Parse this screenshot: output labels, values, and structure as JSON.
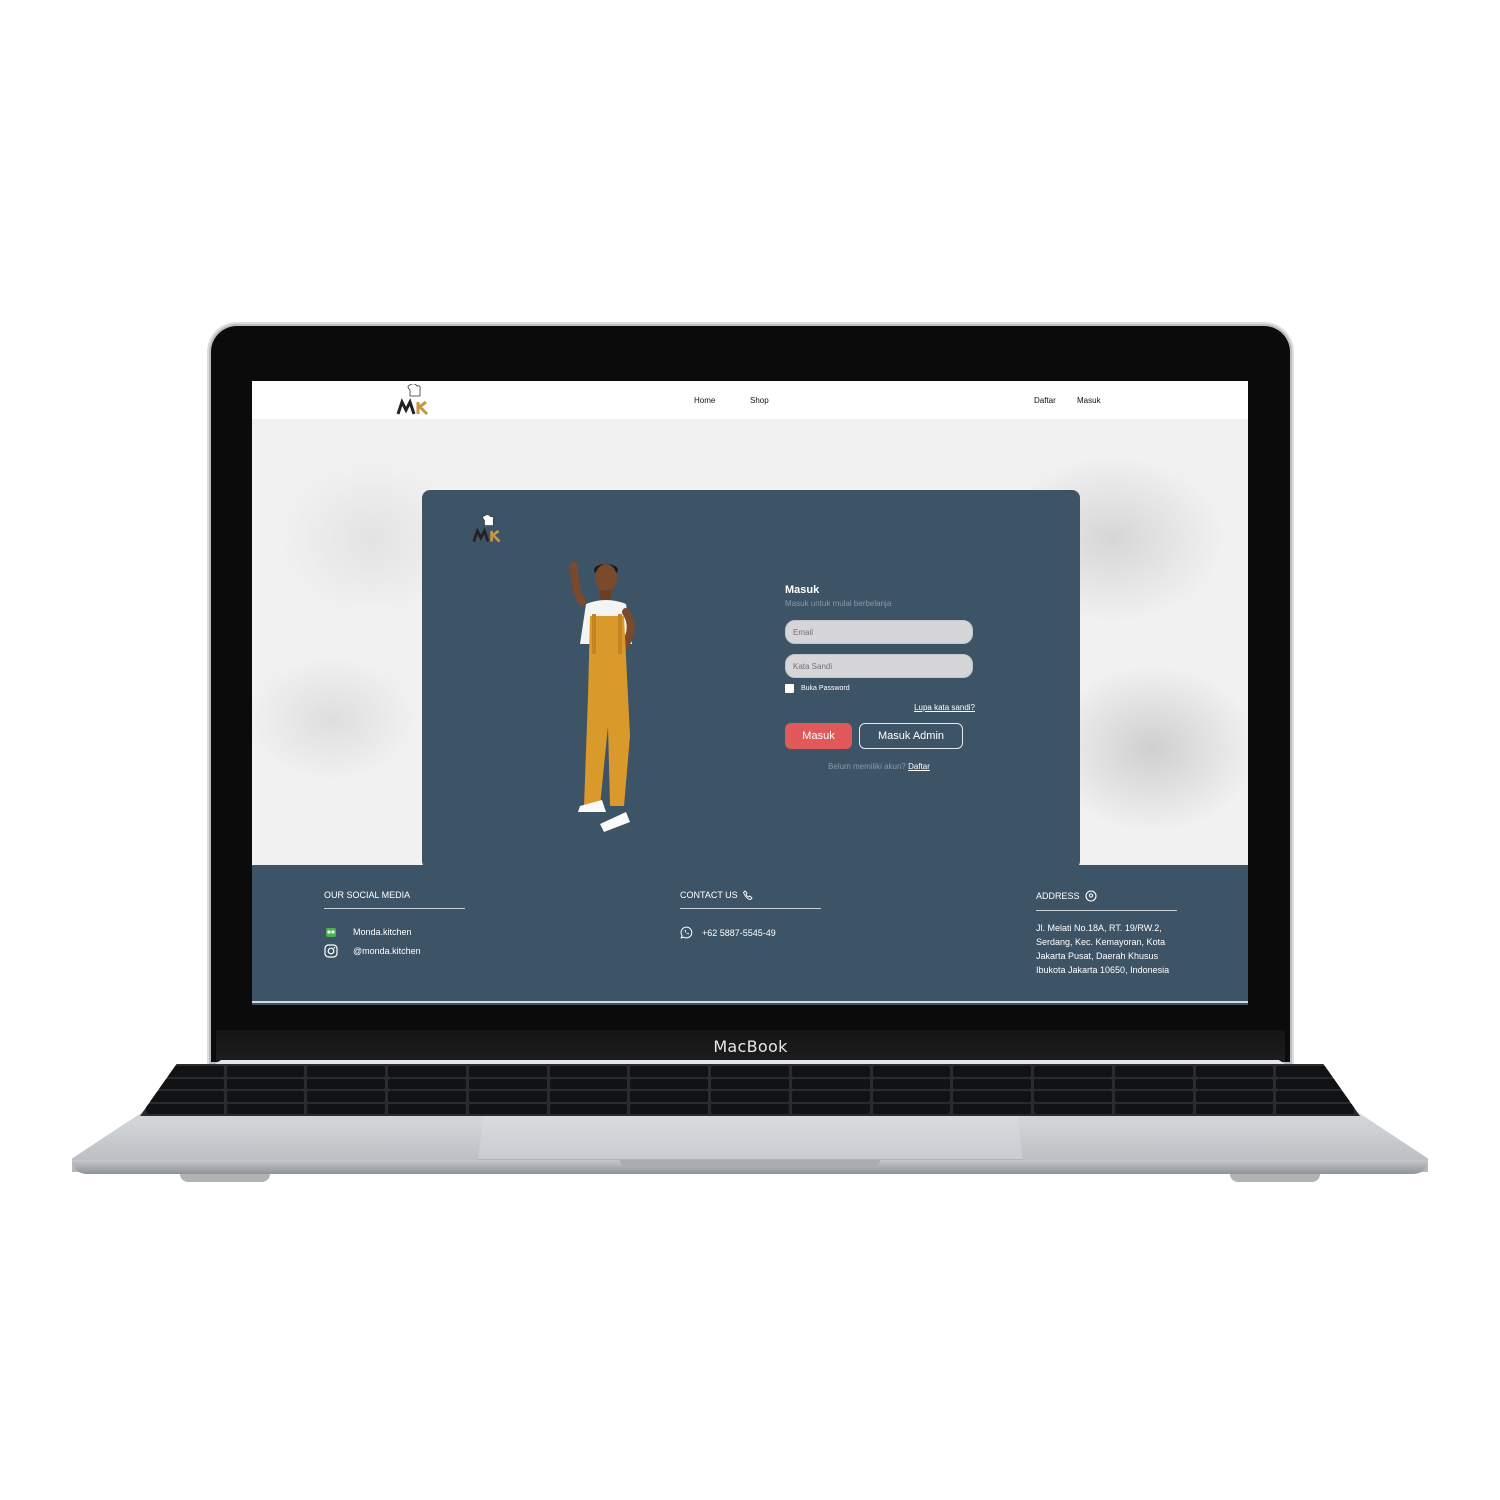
{
  "device": {
    "brand": "MacBook"
  },
  "nav": {
    "links": [
      "Home",
      "Shop"
    ],
    "auth": [
      "Daftar",
      "Masuk"
    ]
  },
  "login": {
    "title": "Masuk",
    "subtitle": "Masuk untuk mulai berbelanja",
    "email_placeholder": "Email",
    "password_placeholder": "Kata Sandi",
    "show_password_label": "Buka Password",
    "forgot_label": "Lupa kata sandi?",
    "login_button": "Masuk",
    "admin_button": "Masuk Admin",
    "no_account_text": "Belum memiliki akun?",
    "register_link": "Daftar"
  },
  "footer": {
    "social": {
      "title": "OUR SOCIAL MEDIA",
      "items": [
        "Monda.kitchen",
        "@monda.kitchen"
      ]
    },
    "contact": {
      "title": "CONTACT US",
      "phone": "+62 5887-5545-49"
    },
    "address": {
      "title": "ADDRESS",
      "text": "Jl. Melati No.18A, RT. 19/RW.2, Serdang, Kec. Kemayoran, Kota Jakarta Pusat, Daerah Khusus Ibukota Jakarta 10650, Indonesia"
    }
  },
  "colors": {
    "panel": "#3d5366",
    "accent_button": "#e2595c",
    "logo_gold": "#c9973f"
  }
}
